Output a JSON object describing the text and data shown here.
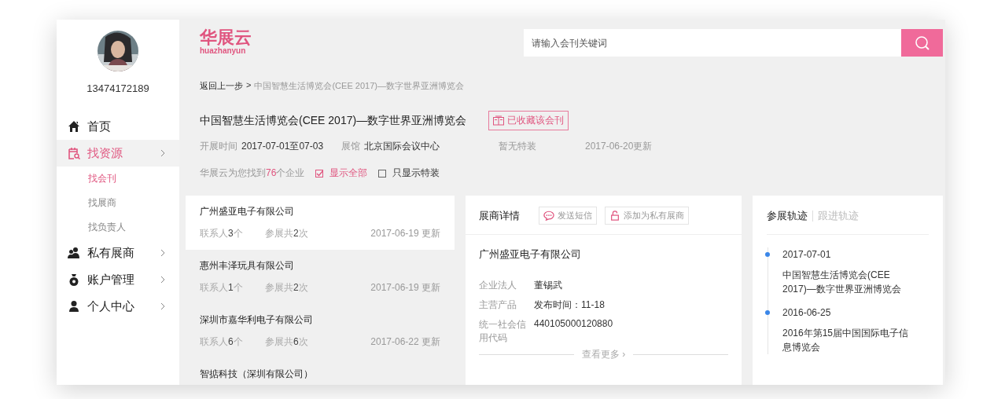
{
  "user": {
    "phone": "13474172189"
  },
  "menu": [
    {
      "label": "首页",
      "selected": false,
      "expandable": false
    },
    {
      "label": "找资源",
      "selected": true,
      "expandable": true,
      "children": [
        {
          "label": "找会刊",
          "selected": true
        },
        {
          "label": "找展商",
          "selected": false
        },
        {
          "label": "找负责人",
          "selected": false
        }
      ]
    },
    {
      "label": "私有展商",
      "selected": false,
      "expandable": true
    },
    {
      "label": "账户管理",
      "selected": false,
      "expandable": true
    },
    {
      "label": "个人中心",
      "selected": false,
      "expandable": true
    }
  ],
  "logo": {
    "name": "华展云",
    "sub": "huazhanyun"
  },
  "search": {
    "placeholder": "请输入会刊关键词"
  },
  "breadcrumb": {
    "back": "返回上一步",
    "separator": ">",
    "current": "中国智慧生活博览会(CEE 2017)—数字世界亚洲博览会"
  },
  "fair": {
    "title": "中国智慧生活博览会(CEE 2017)—数字世界亚洲博览会",
    "collect_button": "已收藏该会刊",
    "info": [
      {
        "label": "开展时间",
        "value": "2017-07-01至07-03"
      },
      {
        "label": "展馆",
        "value": "北京国际会议中心"
      },
      {
        "value": "暂无特装"
      },
      {
        "value": "2017-06-20更新"
      }
    ],
    "result": "华展云为您找到**76**个企业",
    "filters": [
      {
        "label": "显示全部",
        "checked": true
      },
      {
        "label": "只显示特装",
        "checked": false
      }
    ]
  },
  "exhibitors": [
    {
      "name": "广州盛亚电子有限公司",
      "contacts": "联系人**3**个",
      "times": "参展共**2**次",
      "updated": "2017-06-19 更新",
      "selected": true
    },
    {
      "name": "惠州丰泽玩具有限公司",
      "contacts": "联系人**1**个",
      "times": "参展共**2**次",
      "updated": "2017-06-19 更新",
      "selected": false
    },
    {
      "name": "深圳市嘉华利电子有限公司",
      "contacts": "联系人**6**个",
      "times": "参展共**6**次",
      "updated": "2017-06-22 更新",
      "selected": false
    },
    {
      "name": "智掂科技（深圳有限公司）",
      "selected": false
    }
  ],
  "detail": {
    "title": "展商详情",
    "sms_button": "发送短信",
    "private_button": "添加为私有展商",
    "company": "广州盛亚电子有限公司",
    "fields": [
      {
        "label": "企业法人",
        "value": "董锡武"
      },
      {
        "label": "主营产品",
        "value": "发布时间：11-18"
      },
      {
        "label": "统一社会信用代码",
        "value": "440105000120880"
      }
    ],
    "more": "查看更多 ›"
  },
  "track": {
    "tabs": [
      {
        "label": "参展轨迹",
        "selected": true
      },
      {
        "label": "跟进轨迹",
        "selected": false
      }
    ],
    "events": [
      {
        "date": "2017-07-01",
        "name": "中国智慧生活博览会(CEE 2017)—数字世界亚洲博览会"
      },
      {
        "date": "2016-06-25",
        "name": "2016年第15届中国国际电子信息博览会"
      }
    ]
  }
}
